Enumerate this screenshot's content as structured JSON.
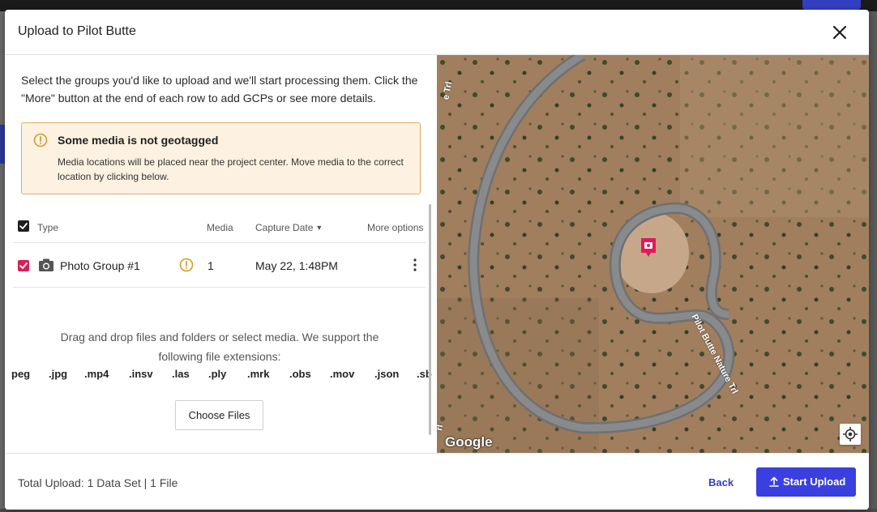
{
  "modal": {
    "title": "Upload to Pilot Butte",
    "intro": "Select the groups you'd like to upload and we'll start processing them. Click the \"More\" button at the end of each row to add GCPs or see more details.",
    "warning": {
      "title": "Some media is not geotagged",
      "body": "Media locations will be placed near the project center. Move media to the correct location by clicking below."
    },
    "table": {
      "headers": {
        "type": "Type",
        "media": "Media",
        "capture_date": "Capture Date",
        "more": "More options"
      },
      "rows": [
        {
          "name": "Photo Group #1",
          "media": "1",
          "date": "May 22, 1:48PM",
          "checked": true,
          "warning_icon": "alert-circle-icon"
        }
      ]
    },
    "dropzone": {
      "text": "Drag and drop files and folders or select media. We support the following file extensions:",
      "extensions": [
        "peg",
        ".jpg",
        ".mp4",
        ".insv",
        ".las",
        ".ply",
        ".mrk",
        ".obs",
        ".mov",
        ".json",
        ".sb"
      ],
      "choose_label": "Choose Files"
    },
    "map": {
      "logo": "Google",
      "road_label_top": "e Trl",
      "road_label_right": "Pilot Butte Nature Trl",
      "road_label_left": "rl"
    },
    "footer": {
      "total": "Total Upload: 1 Data Set | 1 File",
      "back_label": "Back",
      "start_label": "Start Upload"
    }
  },
  "colors": {
    "primary": "#3a3fe0",
    "checkbox_checked": "#d81e5b",
    "warning_border": "#e2ad5c",
    "warning_bg": "#fdf2e2",
    "warning_icon": "#d19a2e",
    "map_marker": "#e0195e"
  }
}
